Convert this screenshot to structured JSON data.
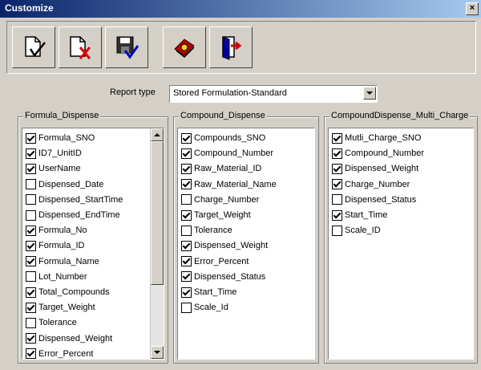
{
  "window": {
    "title": "Customize",
    "close": "×"
  },
  "toolbar": [
    {
      "name": "accept-check-button",
      "icon": "document-check-icon"
    },
    {
      "name": "reject-button",
      "icon": "document-x-icon"
    },
    {
      "name": "save-button",
      "icon": "floppy-check-icon"
    },
    {
      "name": "help-button",
      "icon": "book-icon"
    },
    {
      "name": "exit-button",
      "icon": "exit-door-icon"
    }
  ],
  "report": {
    "label": "Report type",
    "value": "Stored Formulation-Standard"
  },
  "groups": [
    {
      "title": "Formula_Dispense",
      "scroll_fraction": 0.0,
      "items": [
        {
          "label": "Formula_SNO",
          "checked": true
        },
        {
          "label": "ID7_UnitID",
          "checked": true
        },
        {
          "label": "UserName",
          "checked": true
        },
        {
          "label": "Dispensed_Date",
          "checked": false
        },
        {
          "label": "Dispensed_StartTime",
          "checked": false
        },
        {
          "label": "Dispensed_EndTime",
          "checked": false
        },
        {
          "label": "Formula_No",
          "checked": true
        },
        {
          "label": "Formula_ID",
          "checked": true
        },
        {
          "label": "Formula_Name",
          "checked": true
        },
        {
          "label": "Lot_Number",
          "checked": false
        },
        {
          "label": "Total_Compounds",
          "checked": true
        },
        {
          "label": "Target_Weight",
          "checked": true
        },
        {
          "label": "Tolerance",
          "checked": false
        },
        {
          "label": "Dispensed_Weight",
          "checked": true
        },
        {
          "label": "Error_Percent",
          "checked": true
        }
      ]
    },
    {
      "title": "Compound_Dispense",
      "items": [
        {
          "label": "Compounds_SNO",
          "checked": true
        },
        {
          "label": "Compound_Number",
          "checked": true
        },
        {
          "label": "Raw_Material_ID",
          "checked": true
        },
        {
          "label": "Raw_Material_Name",
          "checked": true
        },
        {
          "label": "Charge_Number",
          "checked": false
        },
        {
          "label": "Target_Weight",
          "checked": true
        },
        {
          "label": "Tolerance",
          "checked": false
        },
        {
          "label": "Dispensed_Weight",
          "checked": true
        },
        {
          "label": "Error_Percent",
          "checked": true
        },
        {
          "label": "Dispensed_Status",
          "checked": true
        },
        {
          "label": "Start_Time",
          "checked": true
        },
        {
          "label": "Scale_Id",
          "checked": false
        }
      ]
    },
    {
      "title": "CompoundDispense_Multi_Charge",
      "items": [
        {
          "label": "Mutli_Charge_SNO",
          "checked": true
        },
        {
          "label": "Compound_Number",
          "checked": true
        },
        {
          "label": "Dispensed_Weight",
          "checked": true
        },
        {
          "label": "Charge_Number",
          "checked": true
        },
        {
          "label": "Dispensed_Status",
          "checked": false
        },
        {
          "label": "Start_Time",
          "checked": true
        },
        {
          "label": "Scale_ID",
          "checked": false
        }
      ]
    }
  ]
}
